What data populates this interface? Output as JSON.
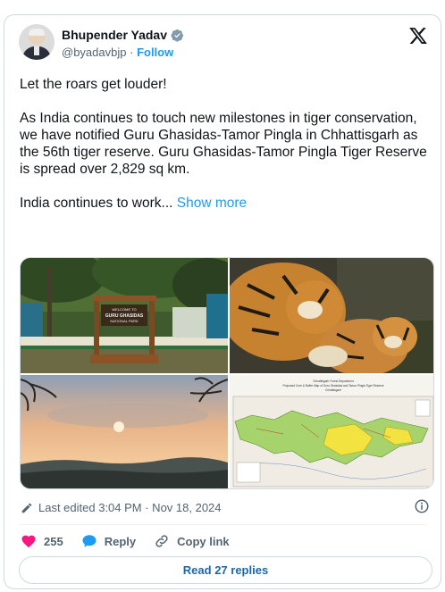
{
  "author": {
    "name": "Bhupender Yadav",
    "handle": "@byadavbjp",
    "separator": "·",
    "follow_label": "Follow"
  },
  "tweet": {
    "paragraphs": [
      "Let the roars get louder!",
      "As India continues to touch new milestones in tiger conservation, we have notified Guru Ghasidas-Tamor Pingla in Chhattisgarh as the 56th tiger reserve. Guru Ghasidas-Tamor Pingla Tiger Reserve is spread over 2,829 sq km."
    ],
    "truncated_text": "India continues to work...",
    "show_more_label": "Show more"
  },
  "media": {
    "sign_lines": [
      "WELCOME TO",
      "GURU GHASIDAS",
      "NATIONAL PARK"
    ],
    "map_title_lines": [
      "Chhattisgarh Forest Department",
      "Proposed Core & Buffer Map of Guru Ghasidas and Tamor Pingla Tiger Reserve",
      "Chhattisgarh"
    ]
  },
  "meta": {
    "edited_text": "Last edited 3:04 PM · Nov 18, 2024"
  },
  "engagement": {
    "likes": "255",
    "reply_label": "Reply",
    "copy_link_label": "Copy link",
    "read_replies_label": "Read 27 replies"
  },
  "colors": {
    "accent": "#1d9bf0",
    "like": "#f91880",
    "text": "#0f1419",
    "muted": "#536471"
  }
}
